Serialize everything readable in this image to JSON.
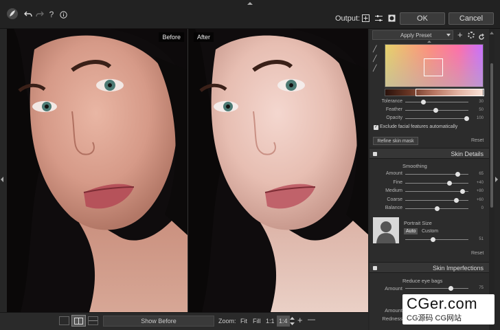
{
  "toolbar": {
    "output_label": "Output:",
    "ok_label": "OK",
    "cancel_label": "Cancel"
  },
  "image": {
    "before_label": "Before",
    "after_label": "After"
  },
  "bottombar": {
    "show_before_label": "Show Before",
    "zoom_label": "Zoom:",
    "fit_label": "Fit",
    "fill_label": "Fill",
    "one_to_one_label": "1:1",
    "one_to_four_label": "1:4",
    "plus_label": "+",
    "minus_label": "—"
  },
  "panel": {
    "preset_label": "Apply Preset",
    "mask": {
      "tolerance_label": "Tolerance",
      "tolerance_value": "30",
      "feather_label": "Feather",
      "feather_value": "50",
      "opacity_label": "Opacity",
      "opacity_value": "100",
      "exclude_label": "Exclude facial features automatically",
      "refine_label": "Refine skin mask",
      "reset_label": "Reset"
    },
    "skin_details": {
      "title": "Skin Details",
      "smoothing_label": "Smoothing",
      "sliders": [
        {
          "label": "Amount",
          "value": "65",
          "level": 0.83
        },
        {
          "label": "Fine",
          "value": "+40",
          "level": 0.7
        },
        {
          "label": "Medium",
          "value": "+80",
          "level": 0.9
        },
        {
          "label": "Coarse",
          "value": "+60",
          "level": 0.8
        },
        {
          "label": "Balance",
          "value": "0",
          "level": 0.5
        }
      ],
      "portrait_size_label": "Portrait Size",
      "auto_label": "Auto",
      "custom_label": "Custom",
      "portrait_value": "51",
      "reset_label": "Reset"
    },
    "skin_imperfections": {
      "title": "Skin Imperfections",
      "reduce_eye_bags_label": "Reduce eye bags",
      "amount_label": "Amount",
      "amount_value": "75",
      "amount2_label": "Amount",
      "redness_label": "Redness"
    }
  },
  "watermark": {
    "line1": "CGer.com",
    "line2": "CG源码  CG网站"
  },
  "colors": {
    "accent": "#ff8a7a",
    "panel_bg": "#2c2c2c",
    "toolbar_bg": "#222222"
  }
}
